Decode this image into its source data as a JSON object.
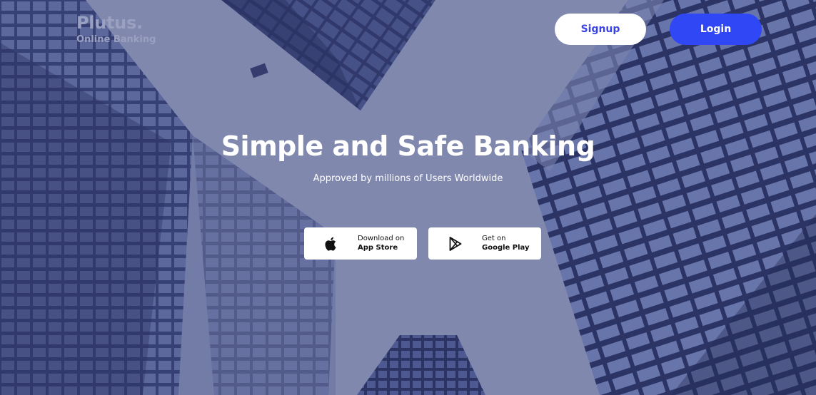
{
  "brand": {
    "name": "Plutus.",
    "tagline": "Online Banking"
  },
  "nav": {
    "signup_label": "Signup",
    "login_label": "Login"
  },
  "hero": {
    "headline": "Simple and Safe Banking",
    "subline": "Approved by millions of Users Worldwide"
  },
  "stores": {
    "apple": {
      "small": "Download on",
      "big": "App Store",
      "icon": "apple-icon"
    },
    "google": {
      "small": "Get on",
      "big": "Google Play",
      "icon": "play-store-icon"
    }
  },
  "colors": {
    "accent": "#2f47f5",
    "signup_text": "#3a43e8",
    "overlay": "#7e86a8"
  }
}
